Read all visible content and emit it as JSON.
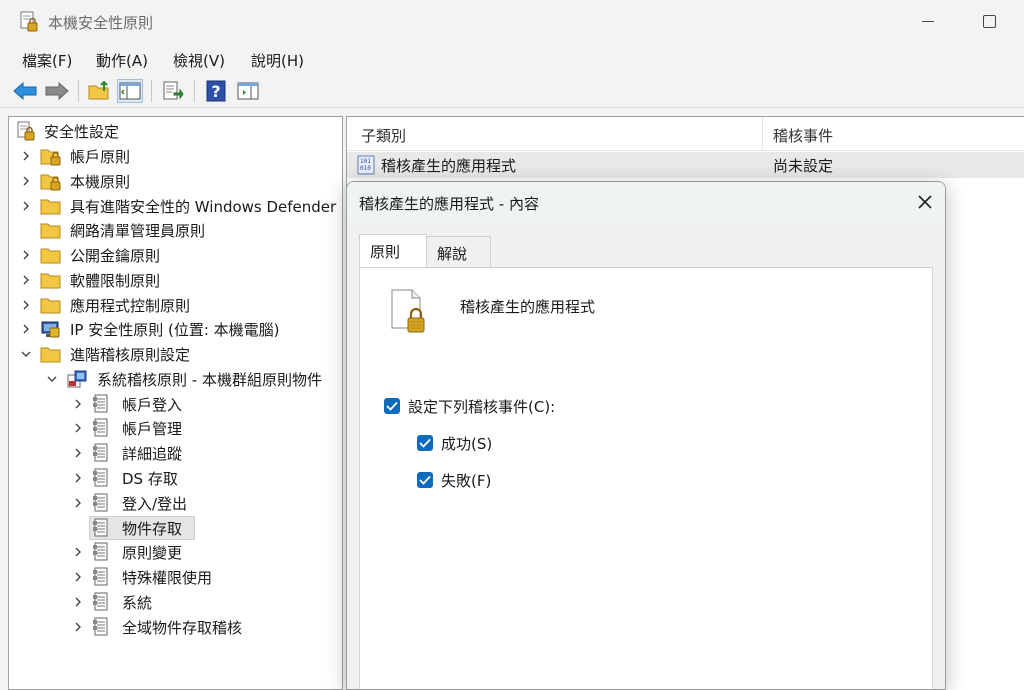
{
  "window": {
    "title": "本機安全性原則"
  },
  "menu": [
    "檔案(F)",
    "動作(A)",
    "檢視(V)",
    "說明(H)"
  ],
  "tree": {
    "root": "安全性設定",
    "items": [
      "帳戶原則",
      "本機原則",
      "具有進階安全性的 Windows Defender",
      "網路清單管理員原則",
      "公開金鑰原則",
      "軟體限制原則",
      "應用程式控制原則",
      "IP 安全性原則 (位置: 本機電腦)",
      "進階稽核原則設定"
    ],
    "sub_root": "系統稽核原則 - 本機群組原則物件",
    "sub_items": [
      "帳戶登入",
      "帳戶管理",
      "詳細追蹤",
      "DS 存取",
      "登入/登出",
      "物件存取",
      "原則變更",
      "特殊權限使用",
      "系統",
      "全域物件存取稽核"
    ],
    "selected": "物件存取"
  },
  "list": {
    "columns": [
      "子類別",
      "稽核事件"
    ],
    "rows": [
      {
        "subcategory": "稽核產生的應用程式",
        "audit": "尚未設定"
      }
    ]
  },
  "dialog": {
    "title": "稽核產生的應用程式 - 內容",
    "tabs": [
      "原則",
      "解說"
    ],
    "policy_name": "稽核產生的應用程式",
    "configure_label": "設定下列稽核事件(C):",
    "success_label": "成功(S)",
    "failure_label": "失敗(F)"
  },
  "colors": {
    "accent": "#0f6cbd",
    "folder": "#f2c744"
  }
}
